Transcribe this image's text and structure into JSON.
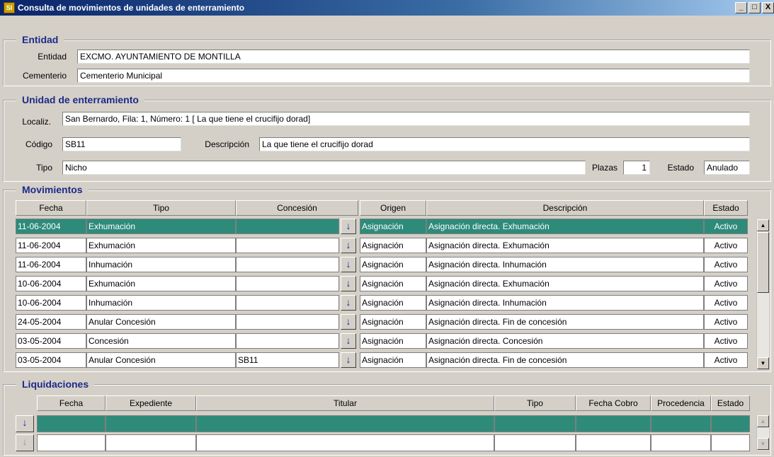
{
  "window": {
    "title": "Consulta de movimientos de unidades de enterramiento",
    "app_icon_text": "SI",
    "controls": [
      "_",
      "□",
      "X"
    ]
  },
  "entidad": {
    "section_title": "Entidad",
    "entidad_label": "Entidad",
    "entidad_value": "EXCMO. AYUNTAMIENTO DE MONTILLA",
    "cementerio_label": "Cementerio",
    "cementerio_value": "Cementerio Municipal"
  },
  "unidad": {
    "section_title": "Unidad de enterramiento",
    "localiz_label": "Localiz.",
    "localiz_value": "San Bernardo, Fila: 1, Número: 1 [ La que tiene el crucifijo dorad]",
    "codigo_label": "Código",
    "codigo_value": "SB11",
    "descripcion_label": "Descripción",
    "descripcion_value": "La que tiene el crucifijo dorad",
    "tipo_label": "Tipo",
    "tipo_value": "Nicho",
    "plazas_label": "Plazas",
    "plazas_value": "1",
    "estado_label": "Estado",
    "estado_value": "Anulado"
  },
  "movimientos": {
    "section_title": "Movimientos",
    "columns": [
      "Fecha",
      "Tipo",
      "Concesión",
      "Origen",
      "Descripción",
      "Estado"
    ],
    "lov_icon": "↓",
    "rows": [
      {
        "fecha": "11-06-2004",
        "tipo": "Exhumación",
        "concesion": "",
        "origen": "Asignación",
        "descripcion": "Asignación directa. Exhumación",
        "estado": "Activo",
        "selected": true
      },
      {
        "fecha": "11-06-2004",
        "tipo": "Exhumación",
        "concesion": "",
        "origen": "Asignación",
        "descripcion": "Asignación directa. Exhumación",
        "estado": "Activo"
      },
      {
        "fecha": "11-06-2004",
        "tipo": "Inhumación",
        "concesion": "",
        "origen": "Asignación",
        "descripcion": "Asignación directa. Inhumación",
        "estado": "Activo"
      },
      {
        "fecha": "10-06-2004",
        "tipo": "Exhumación",
        "concesion": "",
        "origen": "Asignación",
        "descripcion": "Asignación directa. Exhumación",
        "estado": "Activo"
      },
      {
        "fecha": "10-06-2004",
        "tipo": "Inhumación",
        "concesion": "",
        "origen": "Asignación",
        "descripcion": "Asignación directa. Inhumación",
        "estado": "Activo"
      },
      {
        "fecha": "24-05-2004",
        "tipo": "Anular Concesión",
        "concesion": "",
        "origen": "Asignación",
        "descripcion": "Asignación directa. Fin de concesión",
        "estado": "Activo"
      },
      {
        "fecha": "03-05-2004",
        "tipo": "Concesión",
        "concesion": "",
        "origen": "Asignación",
        "descripcion": "Asignación directa. Concesión",
        "estado": "Activo"
      },
      {
        "fecha": "03-05-2004",
        "tipo": "Anular Concesión",
        "concesion": "SB11",
        "origen": "Asignación",
        "descripcion": "Asignación directa. Fin de concesión",
        "estado": "Activo"
      }
    ]
  },
  "liquidaciones": {
    "section_title": "Liquidaciones",
    "columns": [
      "Fecha",
      "Expediente",
      "Titular",
      "Tipo",
      "Fecha Cobro",
      "Procedencia",
      "Estado"
    ],
    "lov_icon": "↓"
  },
  "scrollbar": {
    "up_arrow": "▲",
    "down_arrow": "▼"
  }
}
